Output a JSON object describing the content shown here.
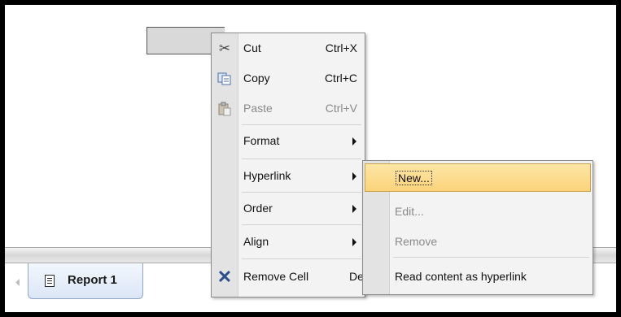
{
  "context_menu": {
    "items": [
      {
        "label": "Cut",
        "shortcut": "Ctrl+X",
        "icon": "scissors-icon",
        "enabled": true
      },
      {
        "label": "Copy",
        "shortcut": "Ctrl+C",
        "icon": "copy-icon",
        "enabled": true
      },
      {
        "label": "Paste",
        "shortcut": "Ctrl+V",
        "icon": "paste-icon",
        "enabled": false
      },
      {
        "label": "Format",
        "has_submenu": true
      },
      {
        "label": "Hyperlink",
        "has_submenu": true
      },
      {
        "label": "Order",
        "has_submenu": true
      },
      {
        "label": "Align",
        "has_submenu": true
      },
      {
        "label": "Remove Cell",
        "shortcut": "Del",
        "icon": "remove-x-icon",
        "enabled": true
      }
    ]
  },
  "hyperlink_submenu": {
    "items": [
      {
        "label": "New...",
        "enabled": true,
        "highlighted": true
      },
      {
        "label": "Edit...",
        "enabled": false
      },
      {
        "label": "Remove",
        "enabled": false
      },
      {
        "label": "Read content as hyperlink",
        "enabled": true
      }
    ]
  },
  "tabs": [
    {
      "label": "Report 1",
      "icon": "document-icon",
      "active": true
    }
  ],
  "colors": {
    "highlight": "#fbd37a",
    "tab_border": "#8ea6c8",
    "menu_bg": "#f3f3f3"
  }
}
